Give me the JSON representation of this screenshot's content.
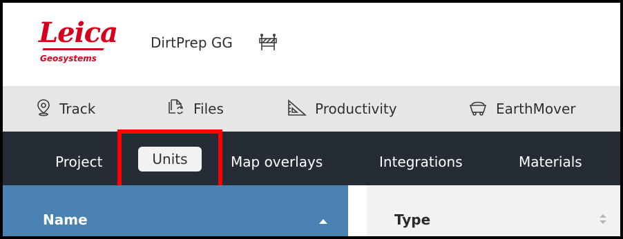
{
  "brand": {
    "logo_text": "Leica",
    "logo_subtext": "Geosystems",
    "brand_color": "#d6001c"
  },
  "header": {
    "project_name": "DirtPrep GG",
    "project_icon": "construction-barrier-icon"
  },
  "main_nav": [
    {
      "label": "Track",
      "icon": "location-pin-icon"
    },
    {
      "label": "Files",
      "icon": "files-sync-icon"
    },
    {
      "label": "Productivity",
      "icon": "set-square-icon"
    },
    {
      "label": "EarthMover",
      "icon": "mining-cart-icon"
    }
  ],
  "settings_tabs": [
    {
      "label": "Project",
      "active": false
    },
    {
      "label": "Units",
      "active": true
    },
    {
      "label": "Map overlays",
      "active": false
    },
    {
      "label": "Integrations",
      "active": false
    },
    {
      "label": "Materials",
      "active": false
    }
  ],
  "table": {
    "columns": [
      {
        "label": "Name",
        "sort": "ascending"
      },
      {
        "label": "Type",
        "sort": "none"
      }
    ]
  },
  "colors": {
    "tab_bar": "#262c36",
    "name_header": "#4a82b3",
    "highlight": "#ff0000"
  }
}
